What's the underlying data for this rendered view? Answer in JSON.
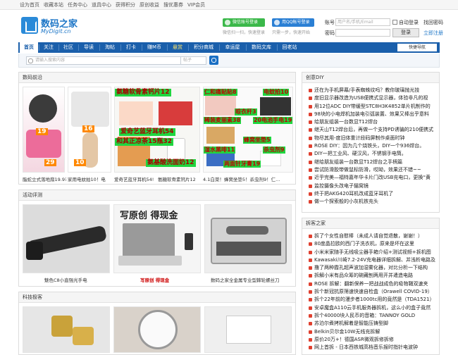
{
  "topbar": {
    "links": [
      "设为首页",
      "收藏本站",
      "任务中心",
      "道具中心",
      "获得积分",
      "原创收益",
      "搜优惠券",
      "VIP会员"
    ]
  },
  "logo": {
    "name": "数码之家",
    "domain": "MyDigit.cn"
  },
  "social": {
    "wechat_label": "微信账号登录",
    "wechat_hint": "微信扫一扫，快速登录",
    "qq_label": "用QQ帐号登录",
    "qq_hint": "只需一步，快速开始"
  },
  "login": {
    "user_label": "账号",
    "user_placeholder": "用户名/手机/Email",
    "pass_label": "密码",
    "remember": "自动登录",
    "forgot": "找回密码",
    "login_btn": "登录",
    "register": "立即注册"
  },
  "nav": {
    "items": [
      "首页",
      "关注",
      "社区",
      "导读",
      "淘帖",
      "打卡",
      "赚M币",
      "悬赏",
      "积分商城",
      "幸运屋",
      "数码文库",
      "回老站"
    ],
    "quick": "快捷导航"
  },
  "search": {
    "placeholder": "请输入搜索内容",
    "option": "帖子"
  },
  "colors": {
    "nav": "#1a5fab",
    "accent": "#e0402f",
    "tag": "#1fd63f"
  },
  "sections": {
    "featured": {
      "title": "数码前沿",
      "captions": [
        "脂蛇立式落地扇19.9?",
        "家用电蚊拍10！电",
        "爱奇艺蓝牙耳机54!",
        "氨糖软骨素钙片12",
        "4.1白菜！蜂窝坐垫5！杀虫剂9！仁..."
      ]
    },
    "reviews": {
      "title": "活动评测",
      "captions": [
        "魅色C8小直强光手电",
        "写原创 得现金",
        "数码之家全金属专业型棘轮螺丝刀"
      ]
    },
    "tech": {
      "title": "科技极客"
    },
    "diy": {
      "title": "创意DIY",
      "items": [
        "还在为手机屏幕/手表蜘蛛纹吗？教你玻璃抛光技",
        "度旧显示器改造为USB便携式显示器，体验非凡的视",
        "用12位ADC DIY带缓型STC8H3K4852单片机制作的",
        "98块的小电焊机加装电引弧装置、效果又棒出乎意料",
        "给朋友组装一台数显T12焊台",
        "继天山T12焊台后，再做一个支持PD诱骗的210便携式",
        "物尽其用-度旧体重计段码屏制作桌面时钟",
        "ROSE DIY：因为几个烧铁头，DIY一个936焊台。",
        "DIY一把工业风、硬汉风，不锈钢手电筒。",
        "继给朋友组装一台数显T12焊台之手柄篇",
        "尝试防滑胶带做鼠标防滑，哎呦，效果还不错~~",
        "近乎完美—福特嘉年华卡片门改USB充电口，更换“黄",
        "监控摄像头改电子猫窝镜",
        "终于把AKG420耳机改成蓝牙耳机了",
        "做一个探索般的小灰机铁充头"
      ]
    },
    "teardown": {
      "title": "拆客之家",
      "items": [
        "拆了个女性自慰棒（未成人请自觉退散，谢谢！）",
        "80度晶拉欧的西门子洗衣机，原来是坏在这里",
        "小米米家随手无线吸尘器手箱介绍+测试视频+拆机图",
        "Kawasaki川崎7.2-24V充电器详细拆解、并浅析电路及",
        "撸了两种霞孔超声波加湿雾化器，对比分析一下结构",
        "拆解小米有品众筹的碗藏刨两用开并遣造电路",
        "ROSE 拆解：翻新保养一把战战成色的吸物鞘双速夹",
        "拆个新冠抗原筛速快速自检盒（Orawell COVID-19）",
        "拆个22年前的漫步者1000tc用的竟然是（TDA1521）",
        "安卓魔盒A110云手机服务器拆机，这么小的盒子竟然",
        "拆个40000块人民币的音箱：TANNOY GOLD",
        "苏泊尔煮拷机解着是智能压铸型脚",
        "Belkin贝尔金10W无线充拆解",
        "原价20万+！德国ASR微观拆修拆修",
        "网上首拆 - 日本西铁城高档音乐报时指针电波钟"
      ]
    }
  }
}
